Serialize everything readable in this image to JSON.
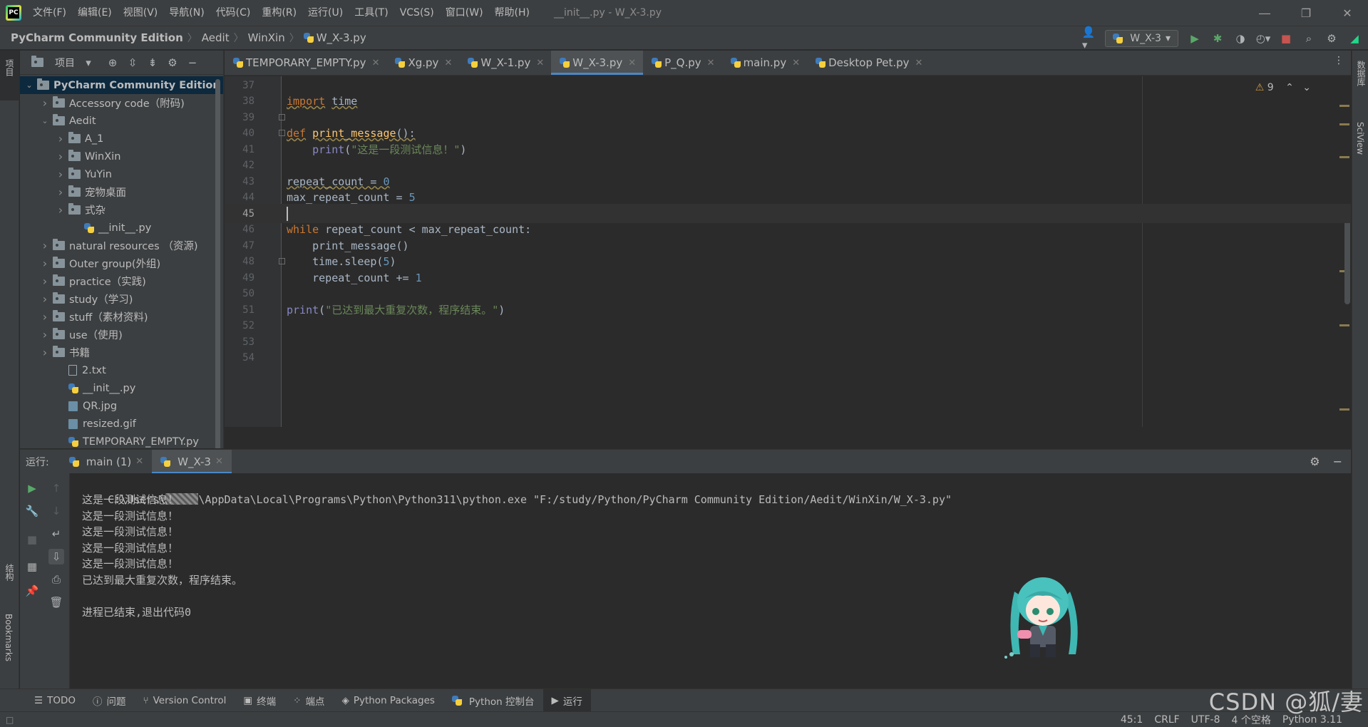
{
  "menu": [
    "文件(F)",
    "编辑(E)",
    "视图(V)",
    "导航(N)",
    "代码(C)",
    "重构(R)",
    "运行(U)",
    "工具(T)",
    "VCS(S)",
    "窗口(W)",
    "帮助(H)"
  ],
  "window_title": "__init__.py - W_X-3.py",
  "breadcrumbs": [
    "PyCharm Community Edition",
    "Aedit",
    "WinXin",
    "W_X-3.py"
  ],
  "run_config": "W_X-3",
  "left_stripe": {
    "project": "项目",
    "structure": "结构",
    "bookmarks": "Bookmarks"
  },
  "right_stripe": {
    "database": "数据库",
    "sciview": "SciView"
  },
  "project_panel": {
    "title": "项目",
    "tree": [
      {
        "label": "PyCharm Community Edition",
        "depth": 0,
        "type": "folder",
        "expanded": true
      },
      {
        "label": "Accessory code（附码)",
        "depth": 1,
        "type": "folder",
        "expanded": false
      },
      {
        "label": "Aedit",
        "depth": 1,
        "type": "folder",
        "expanded": true
      },
      {
        "label": "A_1",
        "depth": 2,
        "type": "folder",
        "expanded": false
      },
      {
        "label": "WinXin",
        "depth": 2,
        "type": "folder",
        "expanded": false
      },
      {
        "label": "YuYin",
        "depth": 2,
        "type": "folder",
        "expanded": false
      },
      {
        "label": "宠物桌面",
        "depth": 2,
        "type": "folder",
        "expanded": false
      },
      {
        "label": "式杂",
        "depth": 2,
        "type": "folder",
        "expanded": false
      },
      {
        "label": "__init__.py",
        "depth": 3,
        "type": "py"
      },
      {
        "label": "natural resources （资源)",
        "depth": 1,
        "type": "folder",
        "expanded": false
      },
      {
        "label": "Outer group(外组)",
        "depth": 1,
        "type": "folder",
        "expanded": false
      },
      {
        "label": "practice（实践)",
        "depth": 1,
        "type": "folder",
        "expanded": false
      },
      {
        "label": "study（学习)",
        "depth": 1,
        "type": "folder",
        "expanded": false
      },
      {
        "label": "stuff（素材资料)",
        "depth": 1,
        "type": "folder",
        "expanded": false
      },
      {
        "label": "use（使用)",
        "depth": 1,
        "type": "folder",
        "expanded": false
      },
      {
        "label": "书籍",
        "depth": 1,
        "type": "folder",
        "expanded": false
      },
      {
        "label": "2.txt",
        "depth": 2,
        "type": "txt"
      },
      {
        "label": "__init__.py",
        "depth": 2,
        "type": "py"
      },
      {
        "label": "QR.jpg",
        "depth": 2,
        "type": "img"
      },
      {
        "label": "resized.gif",
        "depth": 2,
        "type": "img"
      },
      {
        "label": "TEMPORARY_EMPTY.py",
        "depth": 2,
        "type": "py"
      }
    ]
  },
  "editor_tabs": [
    {
      "label": "TEMPORARY_EMPTY.py",
      "active": false
    },
    {
      "label": "Xg.py",
      "active": false
    },
    {
      "label": "W_X-1.py",
      "active": false
    },
    {
      "label": "W_X-3.py",
      "active": true
    },
    {
      "label": "P_Q.py",
      "active": false
    },
    {
      "label": "main.py",
      "active": false
    },
    {
      "label": "Desktop Pet.py",
      "active": false
    }
  ],
  "editor": {
    "warnings": "9",
    "current_line": 45,
    "lines": [
      {
        "n": "37",
        "html": ""
      },
      {
        "n": "38",
        "html": "<span class='kw under'>import</span> <span class='under'>time</span>"
      },
      {
        "n": "39",
        "html": ""
      },
      {
        "n": "40",
        "html": "<span class='kw under'>def</span> <span class='fn under'>print_message</span><span class='under'>():</span>"
      },
      {
        "n": "41",
        "html": "    <span class='bi'>print</span>(<span class='str'>\"这是一段测试信息！\"</span>)"
      },
      {
        "n": "42",
        "html": ""
      },
      {
        "n": "43",
        "html": "<span class='under'>repeat_count = <span class='num'>0</span></span>"
      },
      {
        "n": "44",
        "html": "max_repeat_count = <span class='num'>5</span>"
      },
      {
        "n": "45",
        "html": "<span class='caret'></span>"
      },
      {
        "n": "46",
        "html": "<span class='kw'>while</span> repeat_count &lt; max_repeat_count:"
      },
      {
        "n": "47",
        "html": "    print_message()"
      },
      {
        "n": "48",
        "html": "    time.sleep(<span class='num'>5</span>)"
      },
      {
        "n": "49",
        "html": "    repeat_count += <span class='num'>1</span>"
      },
      {
        "n": "50",
        "html": ""
      },
      {
        "n": "51",
        "html": "<span class='bi'>print</span>(<span class='str'>\"已达到最大重复次数，程序结束。\"</span>)"
      },
      {
        "n": "52",
        "html": ""
      },
      {
        "n": "53",
        "html": ""
      },
      {
        "n": "54",
        "html": ""
      }
    ]
  },
  "run_panel": {
    "label": "运行:",
    "tabs": [
      {
        "label": "main (1)",
        "active": false
      },
      {
        "label": "W_X-3",
        "active": true
      }
    ],
    "console": {
      "cmd_prefix": "C:\\Users\\",
      "cmd_suffix": "\\AppData\\Local\\Programs\\Python\\Python311\\python.exe \"F:/study/Python/PyCharm Community Edition/Aedit/WinXin/W_X-3.py\"",
      "output": [
        "这是一段测试信息！",
        "这是一段测试信息！",
        "这是一段测试信息！",
        "这是一段测试信息！",
        "这是一段测试信息！",
        "已达到最大重复次数，程序结束。",
        "",
        "进程已结束,退出代码0"
      ]
    }
  },
  "bottom_tools": [
    "TODO",
    "问题",
    "Version Control",
    "终端",
    "端点",
    "Python Packages",
    "Python 控制台",
    "运行"
  ],
  "status": {
    "position": "45:1",
    "line_sep": "CRLF",
    "encoding": "UTF-8",
    "indent": "4 个空格",
    "interpreter": "Python 3.11"
  },
  "watermark": "CSDN @狐/妻"
}
